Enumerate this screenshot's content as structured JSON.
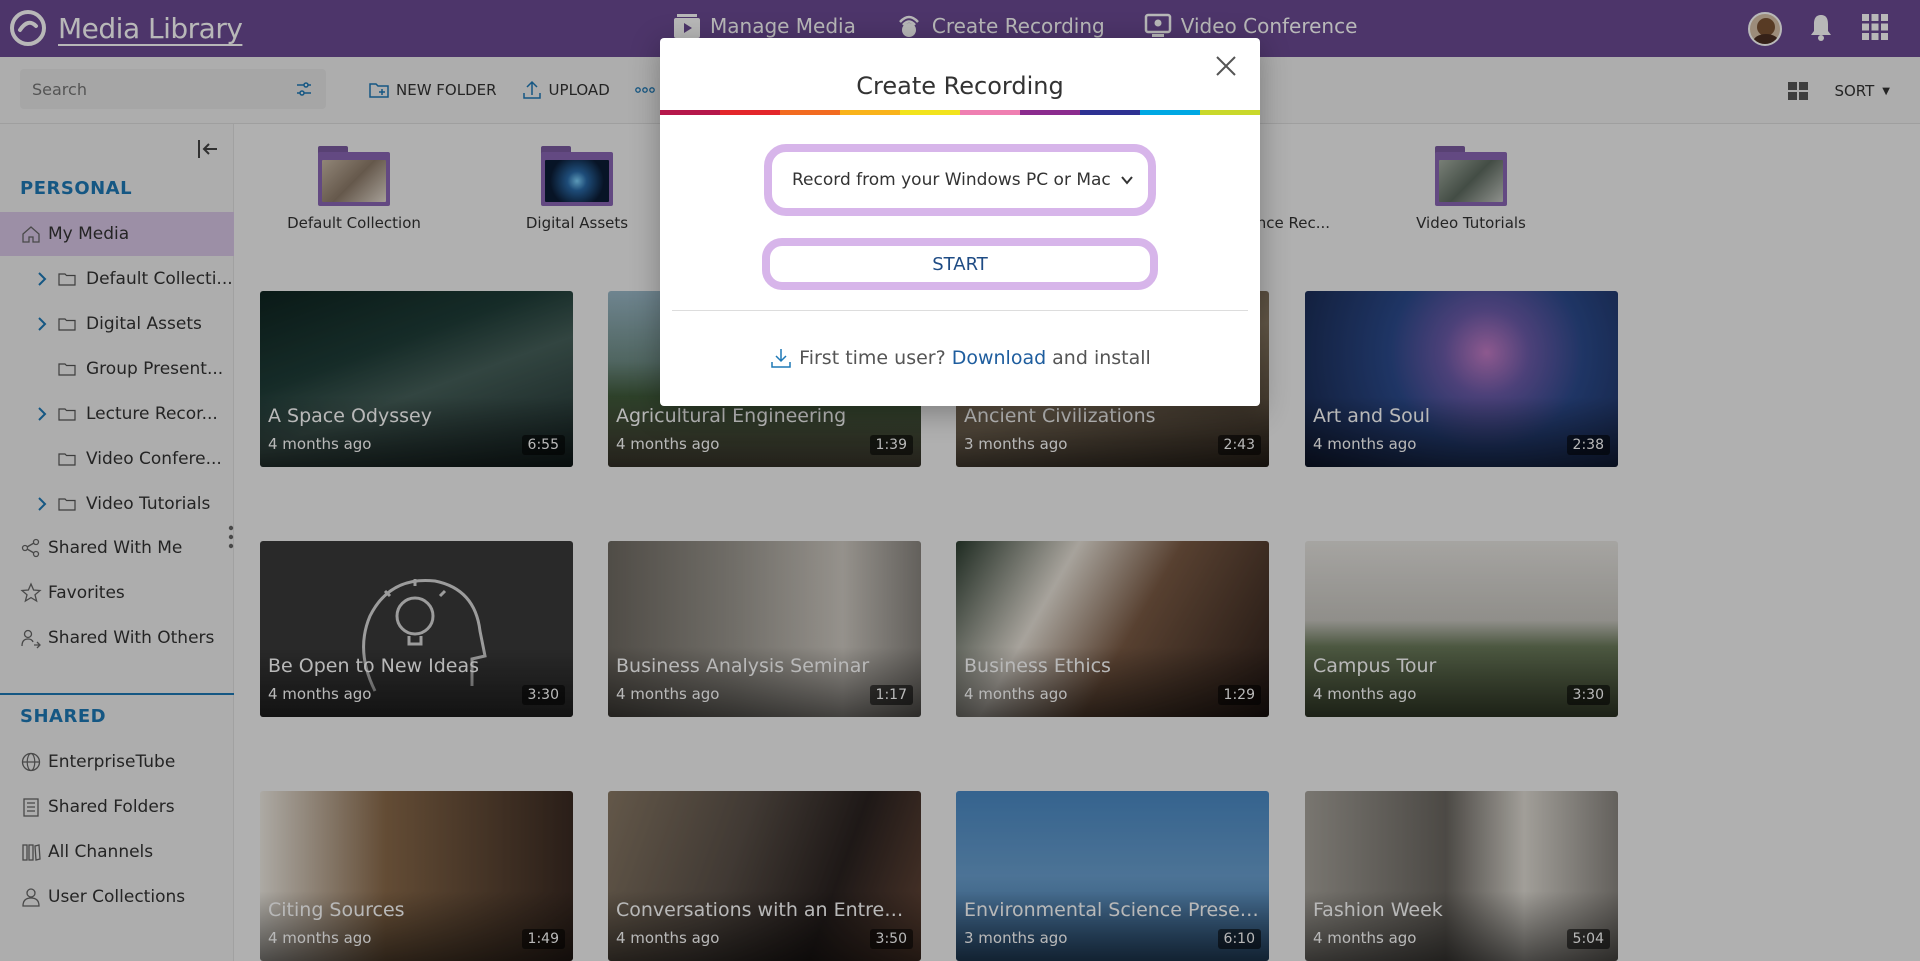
{
  "header": {
    "title": "Media Library",
    "nav": [
      {
        "label": "Manage Media",
        "icon": "manage-media-icon"
      },
      {
        "label": "Create Recording",
        "icon": "create-recording-icon"
      },
      {
        "label": "Video Conference",
        "icon": "video-conference-icon"
      }
    ],
    "colors": {
      "brand": "#6b4a94",
      "accent": "#1e79b6",
      "highlight": "#d7b5ea"
    }
  },
  "toolbar": {
    "search_placeholder": "Search",
    "new_folder": "NEW FOLDER",
    "upload": "UPLOAD",
    "more": "M",
    "sort": "SORT"
  },
  "sidebar": {
    "personal_title": "PERSONAL",
    "my_media": "My Media",
    "subfolders": [
      {
        "label": "Default Collecti...",
        "expandable": true
      },
      {
        "label": "Digital Assets",
        "expandable": true
      },
      {
        "label": "Group Present...",
        "expandable": false
      },
      {
        "label": "Lecture Recor...",
        "expandable": true
      },
      {
        "label": "Video Confere...",
        "expandable": false
      },
      {
        "label": "Video Tutorials",
        "expandable": true
      }
    ],
    "shared_with_me": "Shared With Me",
    "favorites": "Favorites",
    "shared_with_others": "Shared With Others",
    "shared_title": "SHARED",
    "enterprise_tube": "EnterpriseTube",
    "shared_folders": "Shared Folders",
    "all_channels": "All Channels",
    "user_collections": "User Collections"
  },
  "collections": [
    {
      "label": "Default Collection"
    },
    {
      "label": "Digital Assets"
    },
    {
      "label": "ence Rec..."
    },
    {
      "label": "Video Tutorials"
    }
  ],
  "media": [
    {
      "title": "A Space Odyssey",
      "age": "4 months ago",
      "duration": "6:55"
    },
    {
      "title": "Agricultural Engineering",
      "age": "4 months ago",
      "duration": "1:39"
    },
    {
      "title": "Ancient Civilizations",
      "age": "3 months ago",
      "duration": "2:43"
    },
    {
      "title": "Art and Soul",
      "age": "4 months ago",
      "duration": "2:38"
    },
    {
      "title": "Be Open to New Ideas",
      "age": "4 months ago",
      "duration": "3:30"
    },
    {
      "title": "Business Analysis Seminar",
      "age": "4 months ago",
      "duration": "1:17"
    },
    {
      "title": "Business Ethics",
      "age": "4 months ago",
      "duration": "1:29"
    },
    {
      "title": "Campus Tour",
      "age": "4 months ago",
      "duration": "3:30"
    },
    {
      "title": "Citing Sources",
      "age": "4 months ago",
      "duration": "1:49"
    },
    {
      "title": "Conversations with an Entrepren...",
      "age": "4 months ago",
      "duration": "3:50"
    },
    {
      "title": "Environmental Science Presentat...",
      "age": "3 months ago",
      "duration": "6:10"
    },
    {
      "title": "Fashion Week",
      "age": "4 months ago",
      "duration": "5:04"
    }
  ],
  "modal": {
    "title": "Create Recording",
    "select_value": "Record from your Windows PC or Mac",
    "start": "START",
    "first_time": "First time user?",
    "download": "Download",
    "install": "and install"
  }
}
